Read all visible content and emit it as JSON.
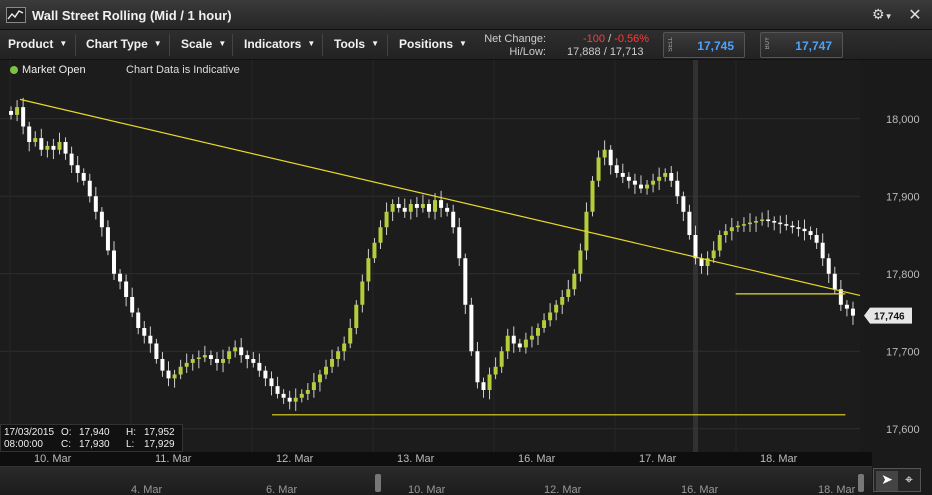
{
  "window": {
    "title": "Wall Street Rolling (Mid / 1 hour)"
  },
  "menu": {
    "product": "Product",
    "chart_type": "Chart Type",
    "scale": "Scale",
    "indicators": "Indicators",
    "tools": "Tools",
    "positions": "Positions"
  },
  "stats": {
    "net_change_label": "Net Change:",
    "net_change_points": "-100",
    "net_change_sep": "/",
    "net_change_pct": "-0.56%",
    "hilow_label": "Hi/Low:",
    "hilow_value": "17,888 / 17,713"
  },
  "sell": {
    "tag": "SELL",
    "price": "17,745"
  },
  "buy": {
    "tag": "BUY",
    "price": "17,747"
  },
  "status": {
    "market": "Market Open",
    "indicative": "Chart Data is Indicative",
    "market_color": "#7bc144"
  },
  "ohlc": {
    "date": "17/03/2015",
    "time": "08:00:00",
    "o_label": "O:",
    "o": "17,940",
    "h_label": "H:",
    "h": "17,952",
    "c_label": "C:",
    "c": "17,930",
    "l_label": "L:",
    "l": "17,929"
  },
  "x_labels": [
    "10. Mar",
    "11. Mar",
    "12. Mar",
    "13. Mar",
    "16. Mar",
    "17. Mar",
    "18. Mar"
  ],
  "nav_labels": [
    "4. Mar",
    "6. Mar",
    "10. Mar",
    "12. Mar",
    "16. Mar",
    "18. Mar"
  ],
  "chart_data": {
    "type": "candlestick",
    "title": "Wall Street Rolling (Mid / 1 hour)",
    "y_ticks": [
      "18,000",
      "17,900",
      "17,800",
      "17,700",
      "17,600"
    ],
    "y_tick_values": [
      18000,
      17900,
      17800,
      17700,
      17600
    ],
    "ylim": [
      17570,
      18050
    ],
    "current_price": "17,746",
    "current_value": 17746,
    "up_color": "#b7cc3b",
    "down_color": "#ffffff",
    "line_color": "#e8d82a",
    "series": [
      {
        "d": "10. Mar",
        "c": [
          18005,
          18015,
          17990,
          17970,
          17975,
          17960,
          17965,
          17960,
          17970,
          17955,
          17940,
          17930,
          17920,
          17900,
          17880,
          17860,
          17830,
          17800,
          17790,
          17770
        ]
      },
      {
        "d": "11. Mar",
        "c": [
          17750,
          17730,
          17720,
          17710,
          17690,
          17675,
          17665,
          17670,
          17680,
          17685,
          17690,
          17692,
          17695,
          17690,
          17685,
          17690,
          17700,
          17705,
          17695,
          17690
        ]
      },
      {
        "d": "12. Mar",
        "c": [
          17685,
          17675,
          17665,
          17655,
          17645,
          17640,
          17635,
          17640,
          17645,
          17650,
          17660,
          17670,
          17680,
          17690,
          17700,
          17710,
          17730,
          17760,
          17790,
          17820
        ]
      },
      {
        "d": "13. Mar",
        "c": [
          17840,
          17860,
          17880,
          17890,
          17885,
          17880,
          17890,
          17885,
          17890,
          17880,
          17895,
          17885,
          17880,
          17860,
          17820,
          17760,
          17700,
          17660,
          17650,
          17670
        ]
      },
      {
        "d": "16. Mar",
        "c": [
          17680,
          17700,
          17720,
          17710,
          17705,
          17715,
          17720,
          17730,
          17740,
          17750,
          17760,
          17770,
          17780,
          17800,
          17830,
          17880,
          17920,
          17950,
          17960,
          17940
        ]
      },
      {
        "d": "17. Mar",
        "c": [
          17930,
          17925,
          17920,
          17915,
          17910,
          17915,
          17920,
          17925,
          17930,
          17920,
          17900,
          17880,
          17850,
          17820,
          17810,
          17820,
          17830,
          17850,
          17855,
          17860
        ]
      },
      {
        "d": "18. Mar",
        "c": [
          17862,
          17864,
          17866,
          17868,
          17870,
          17868,
          17866,
          17864,
          17862,
          17860,
          17858,
          17855,
          17850,
          17840,
          17820,
          17800,
          17780,
          17760,
          17755,
          17746
        ]
      }
    ],
    "trend_lines": [
      {
        "x1": 0.0,
        "y1": 18025,
        "x2": 1.0,
        "y2": 17772
      },
      {
        "x1": 0.3,
        "y1": 17618,
        "x2": 0.983,
        "y2": 17618
      },
      {
        "x1": 0.852,
        "y1": 17774,
        "x2": 0.983,
        "y2": 17774
      }
    ]
  }
}
